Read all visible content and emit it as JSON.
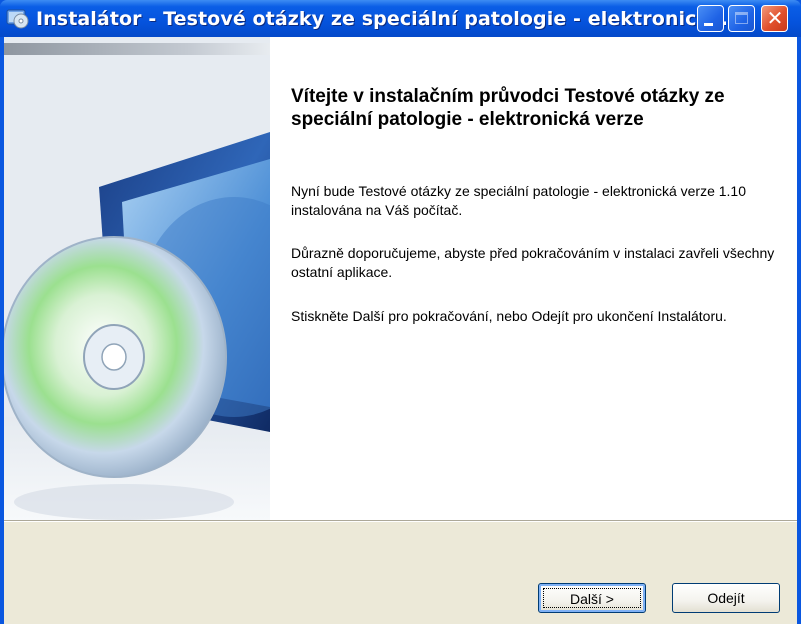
{
  "window": {
    "title": "Instalátor - Testové otázky ze speciální patologie - elektronická...",
    "icon": "installer-cd-icon"
  },
  "titlebar_buttons": {
    "minimize_icon": "minimize-icon",
    "maximize_icon": "maximize-icon",
    "close_icon": "close-icon",
    "close_glyph": "✕"
  },
  "wizard": {
    "heading": "Vítejte v instalačním průvodci Testové otázky ze speciální patologie - elektronická verze",
    "paragraphs": [
      "Nyní bude Testové otázky ze speciální patologie - elektronická verze 1.10 instalována na Váš počítač.",
      "Důrazně doporučujeme, abyste před pokračováním v instalaci zavřeli všechny ostatní aplikace.",
      "Stiskněte Další pro pokračování, nebo Odejít pro ukončení Instalátoru."
    ]
  },
  "buttons": {
    "next_label": "Další >",
    "exit_label": "Odejít"
  },
  "colors": {
    "titlebar": "#0553dd",
    "close_button": "#e1502c",
    "footer": "#ece9d8"
  }
}
